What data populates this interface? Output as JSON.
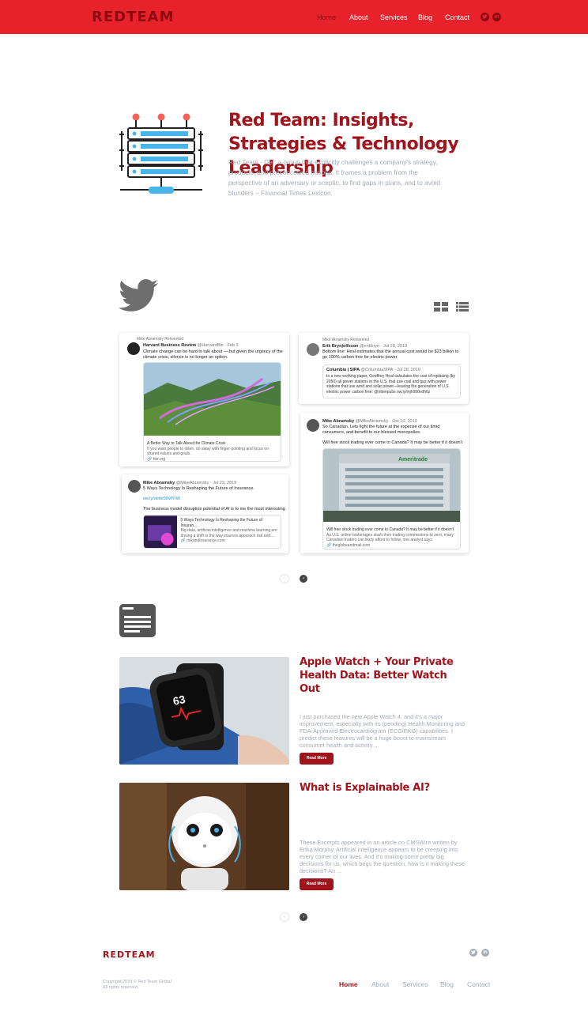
{
  "header": {
    "logo": "REDTEAM",
    "nav": [
      "Home",
      "About",
      "Services",
      "Blog",
      "Contact"
    ],
    "active_nav": "Home",
    "social": [
      "twitter-icon",
      "linkedin-icon"
    ]
  },
  "hero": {
    "title": "Red Team: Insights, Strategies & Technology Leadership",
    "description": "Red Team - Def: a group that explicitly challenges a company's strategy, products, and preconceived notions. It frames a problem from the perspective of an adversary or sceptic, to find gaps in plans, and to avoid blunders – Financial Times Lexicon."
  },
  "tweets": [
    {
      "retweet": "Mike Abramsky Retweeted",
      "name": "Harvard Business Review",
      "handle": "@HarvardBiz · Feb 3",
      "text": "Climate change can be hard to talk about — but given the urgency of the climate crisis, silence is no longer an option.",
      "card_title": "A Better Way to Talk About the Climate Crisis",
      "card_desc": "If you want people to listen, do away with finger-pointing and focus on shared values and goals.",
      "card_link": "hbr.org"
    },
    {
      "retweet": "Mike Abramsky Retweeted",
      "name": "Erik Brynjolfsson",
      "handle": "@erikbryn · Jul 28, 2019",
      "text": "Bottom line: Heal estimates that the annual cost would be $23 billion to go 100% carbon free for electric power",
      "quote_name": "Columbia | SIPA",
      "quote_handle": "@ColumbiaSIPA · Jul 28, 2019",
      "quote_text": "In a new working paper, Geoffrey Heal calculates the cost of replacing (by 2050) all power stations in the U.S. that use coal and gas with power stations that use wind and solar power—leaving the generation of U.S. electric power carbon free: @mberpubs ow.ly/mjh950vdh6z"
    },
    {
      "name": "Mike Abramsky",
      "handle": "@MikeAbramsky · Jul 29, 2019",
      "text": "5 Ways Technology Is Reshaping the Future of Insurance.",
      "link": "ow.ly/otme50vfYIW",
      "text2": "The business model disruption potential of AI is to me the most interesting",
      "card_title": "5 Ways Technology Is Reshaping the Future of Insuran...",
      "card_desc": "Big data, artificial intelligence and machine learning are driving a shift in the way insurers approach risk and ...",
      "card_link": "riskandinsurance.com"
    },
    {
      "name": "Mike Abramsky",
      "handle": "@MikeAbramsky · Oct 10, 2019",
      "text": "So Canadian.    Lets fight the future at the expense of our timid consumers, and benefit to our blessed monopolies.",
      "text2": "Will free stock trading ever come to Canada? It may be better if it doesn't",
      "image_label": "Ameritrade",
      "card_title": "Will free stock trading ever come to Canada? It may be better if it doesn't",
      "card_desc": "As U.S. online brokerages slash their trading commissions to zero, many Canadian traders can likely afford to follow, one analyst says",
      "card_link": "theglobeandmail.com"
    }
  ],
  "pager": {
    "prev": "‹",
    "next": "›"
  },
  "blog": [
    {
      "title": "Apple Watch + Your Private Health Data: Better Watch Out",
      "excerpt": "I just purchased the new Apple Watch 4, and it's a major improvement, especially with its (pending) Health Monitoring and FDA-Approved Electrocardiogram (ECG/EKG) capabilities. I predict these features will be a huge boost to mainstream consumer health and activity ...",
      "button": "Read More",
      "watch_text": "63"
    },
    {
      "title": "What is Explainable AI?",
      "excerpt": "These Excerpts appeared in an article on CMSWire written by Erika Morphy. Artificial intelligence appears to be creeping into every corner of our lives. And it's making some pretty big decisions for us, which begs the question, how is it making these decisions? An ...",
      "button": "Read More"
    }
  ],
  "footer": {
    "logo": "REDTEAM",
    "copyright_line1": "Copyright 2020 © Red Team Global",
    "copyright_line2": "All rights reserved",
    "nav": [
      "Home",
      "About",
      "Services",
      "Blog",
      "Contact"
    ]
  },
  "colors": {
    "brand_red": "#e8222a",
    "dark_red": "#a0141c",
    "muted_text": "#a4acb6"
  }
}
